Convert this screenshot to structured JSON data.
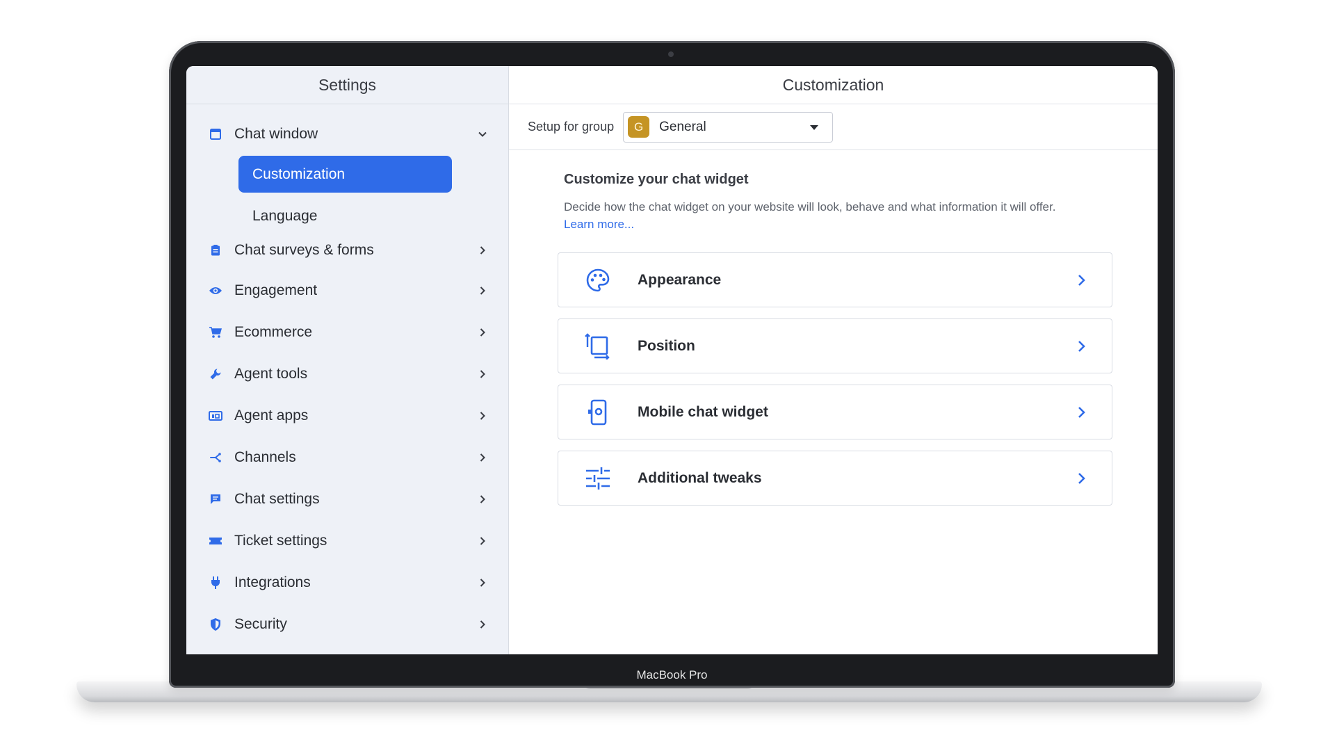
{
  "device": {
    "model_label": "MacBook Pro"
  },
  "colors": {
    "accent": "#2f6be8",
    "sidebar_bg": "#eef1f7",
    "badge": "#c59424"
  },
  "sidebar": {
    "title": "Settings",
    "items": [
      {
        "label": "Chat window",
        "icon": "chat-window-icon",
        "expanded": true
      },
      {
        "label": "Chat surveys & forms",
        "icon": "clipboard-icon"
      },
      {
        "label": "Engagement",
        "icon": "eye-icon"
      },
      {
        "label": "Ecommerce",
        "icon": "cart-icon"
      },
      {
        "label": "Agent tools",
        "icon": "wrench-icon"
      },
      {
        "label": "Agent apps",
        "icon": "apps-icon"
      },
      {
        "label": "Channels",
        "icon": "channels-icon"
      },
      {
        "label": "Chat settings",
        "icon": "chat-bubble-icon"
      },
      {
        "label": "Ticket settings",
        "icon": "ticket-icon"
      },
      {
        "label": "Integrations",
        "icon": "plug-icon"
      },
      {
        "label": "Security",
        "icon": "shield-icon"
      }
    ],
    "subitems": [
      {
        "label": "Customization",
        "active": true
      },
      {
        "label": "Language",
        "active": false
      }
    ]
  },
  "main": {
    "title": "Customization",
    "group": {
      "label": "Setup for group",
      "badge": "G",
      "value": "General"
    },
    "intro": {
      "title": "Customize your chat widget",
      "description": "Decide how the chat widget on your website will look, behave and what information it will offer.",
      "link": "Learn more..."
    },
    "cards": [
      {
        "label": "Appearance",
        "icon": "palette-icon"
      },
      {
        "label": "Position",
        "icon": "position-icon"
      },
      {
        "label": "Mobile chat widget",
        "icon": "mobile-icon"
      },
      {
        "label": "Additional tweaks",
        "icon": "sliders-icon"
      }
    ]
  }
}
